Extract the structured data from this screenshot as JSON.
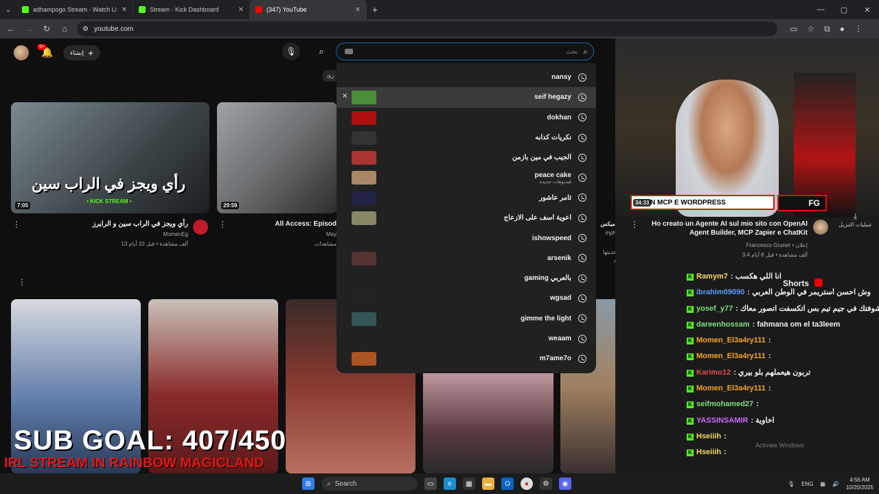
{
  "browser": {
    "tabs": [
      {
        "title": "adhampogo Stream - Watch Li",
        "active": false,
        "fav": "#53fc18"
      },
      {
        "title": "Stream - Kick Dashboard",
        "active": false,
        "fav": "#53fc18"
      },
      {
        "title": "(347) YouTube",
        "active": true,
        "fav": "#ff0000"
      }
    ],
    "url": "youtube.com"
  },
  "header": {
    "notif_count": "9+",
    "create_label": "إنشاء",
    "search_placeholder": "بحث",
    "chip": "رئ"
  },
  "suggestions": [
    {
      "label": "nansy",
      "thumb": null
    },
    {
      "label": "seif hegazy",
      "thumb": "#4a8e3a",
      "highlight": true
    },
    {
      "label": "dokhan",
      "thumb": "#b01010"
    },
    {
      "label": "نكريات كدابه",
      "thumb": "#333"
    },
    {
      "label": "الجيب في مين بازمن",
      "thumb": "#a33"
    },
    {
      "label": "peace cake",
      "sub": "فيديوهات جديدة",
      "thumb": "#a86"
    },
    {
      "label": "ثامر عاشور",
      "thumb": "#224"
    },
    {
      "label": "اعوية اسف على الازعاج",
      "thumb": "#886"
    },
    {
      "label": "ishowspeed",
      "thumb": null
    },
    {
      "label": "arsenik",
      "thumb": "#533"
    },
    {
      "label": "gaming بالعربي",
      "thumb": null
    },
    {
      "label": "wgsad",
      "thumb": "#222"
    },
    {
      "label": "gimme the light",
      "thumb": "#355"
    },
    {
      "label": "weaam",
      "thumb": null
    },
    {
      "label": "m7ame7o",
      "thumb": "#a52"
    }
  ],
  "videos": [
    {
      "title": "رأي ويجز في الراب سين و الرايرز",
      "channel": "MomenEg",
      "meta": "13 ألف مشاهدة • قبل 10 أيام",
      "duration": "7:05",
      "overlay": "رأي ويجز في الراب سين",
      "tag": "• KICK STREAM •"
    },
    {
      "title": "All Access: Episod",
      "channel": "May",
      "meta": "مشاهدات",
      "duration": "29:59"
    },
    {
      "title": "Ho creato un Agente AI sul mio sito con OpenAI Agent Builder, MCP Zapier e ChatKit",
      "channel": "Francesco Gruner • إعلان",
      "meta": "3.4 ألف مشاهدة • قبل 8 أيام",
      "duration": "34:33",
      "overlay": "CON MCP E WORDPRESS",
      "brand": "FG"
    },
    {
      "title": "ميكس | ra",
      "channel": "mphony",
      "meta": "تم تحديثها اليوم"
    }
  ],
  "download_label": "عمليات التنزيل",
  "shorts_label": "Shorts",
  "chat": [
    {
      "user": "Ramym7",
      "msg": ": انا اللي هكسب",
      "color": "#f5d76e"
    },
    {
      "user": "ibrahim09090",
      "msg": ": وش احسن استريمر في الوطن العربي",
      "color": "#5aa0ff"
    },
    {
      "user": "yosef_y77",
      "msg": ": انا شوفتك في جيم تيم بس اتكسفت اتصور معاك",
      "color": "#7ce07c"
    },
    {
      "user": "dareenhossam",
      "msg": ": fahmana om el ta3leem",
      "color": "#7ce07c"
    },
    {
      "user": "Momen_El3a4ry111",
      "msg": ":",
      "color": "#f5a623"
    },
    {
      "user": "Momen_El3a4ry111",
      "msg": ":",
      "color": "#f5a623"
    },
    {
      "user": "Karimo12",
      "msg": ": تربون هيعملهم بلو بيري",
      "color": "#e04b4b"
    },
    {
      "user": "Momen_El3a4ry111",
      "msg": ":",
      "color": "#f5a623"
    },
    {
      "user": "seifmohamed27",
      "msg": ":",
      "color": "#7ce07c"
    },
    {
      "user": "YASSINSAMIR",
      "msg": ": اخاوية",
      "color": "#c86bff"
    },
    {
      "user": "Hseiiih",
      "msg": ":",
      "color": "#f5d76e"
    },
    {
      "user": "Hseiiih",
      "msg": ":",
      "color": "#f5d76e"
    }
  ],
  "overlay": {
    "sub_goal": "SUB GOAL: 407/450",
    "irl": "IRL STREAM IN RAINBOW MAGICLAND",
    "watermark": "Activate Windows"
  },
  "taskbar": {
    "search": "Search",
    "lang": "ENG",
    "time": "4:56 AM",
    "date": "10/20/2025"
  }
}
